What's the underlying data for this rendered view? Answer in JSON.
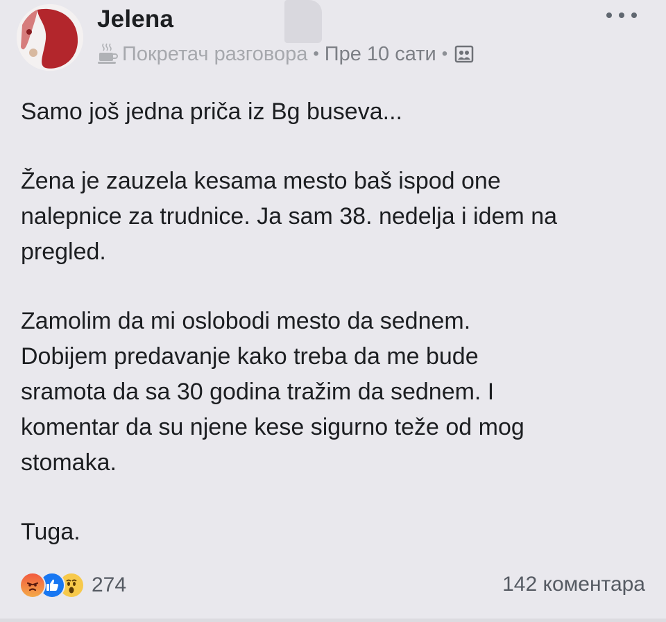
{
  "post": {
    "author": "Jelena",
    "badge_label": "Покретач разговора",
    "time": "Пре 10 сати",
    "separator": "•",
    "icons": {
      "badge": "coffee-cup-icon",
      "audience": "group-audience-icon",
      "more": "more-options-icon"
    },
    "paragraphs": [
      "Samo još jedna priča iz Bg buseva...",
      "Žena je zauzela kesama mesto baš ispod one\nnalepnice za trudnice. Ja sam 38. nedelja i idem na\npregled.",
      "Zamolim da mi oslobodi mesto da sednem.\nDobijem predavanje kako treba da me bude\nsramota da sa 30 godina tražim da sednem. I\nkomentar da su njene kese  sigurno teže od mog\nstomaka.",
      "Tuga."
    ]
  },
  "footer": {
    "reactions": [
      "angry",
      "like",
      "wow"
    ],
    "reaction_count": "274",
    "comment_count": "142 коментара"
  },
  "colors": {
    "background": "#e9e8ed",
    "text": "#1c1e21",
    "meta": "#8c8f95",
    "like_blue": "#1877f2"
  }
}
